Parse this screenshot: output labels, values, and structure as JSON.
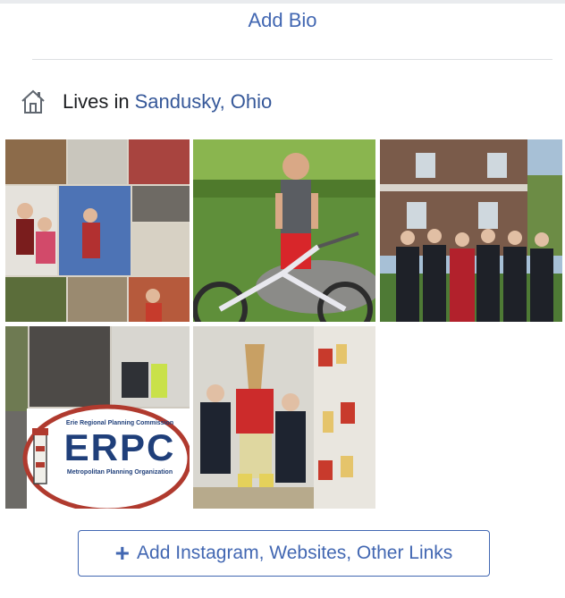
{
  "bio": {
    "add_label": "Add Bio"
  },
  "intro": {
    "lives_prefix": "Lives in",
    "city": "Sandusky, Ohio",
    "icon": "home-icon"
  },
  "photos": [
    {
      "name": "collage-photo"
    },
    {
      "name": "boy-with-bike-photo"
    },
    {
      "name": "group-outside-house-photo"
    },
    {
      "name": "erpc-collage-photo",
      "logo_text": "ERPC",
      "logo_caption_top": "Erie Regional Planning Commission",
      "logo_caption_bottom": "Metropolitan Planning Organization"
    },
    {
      "name": "mascot-giraffe-photo"
    }
  ],
  "links": {
    "add_label": "Add Instagram, Websites, Other Links",
    "icon": "plus-icon"
  },
  "colors": {
    "link": "#4267b2",
    "city": "#365899",
    "divider": "#dddfe2"
  }
}
